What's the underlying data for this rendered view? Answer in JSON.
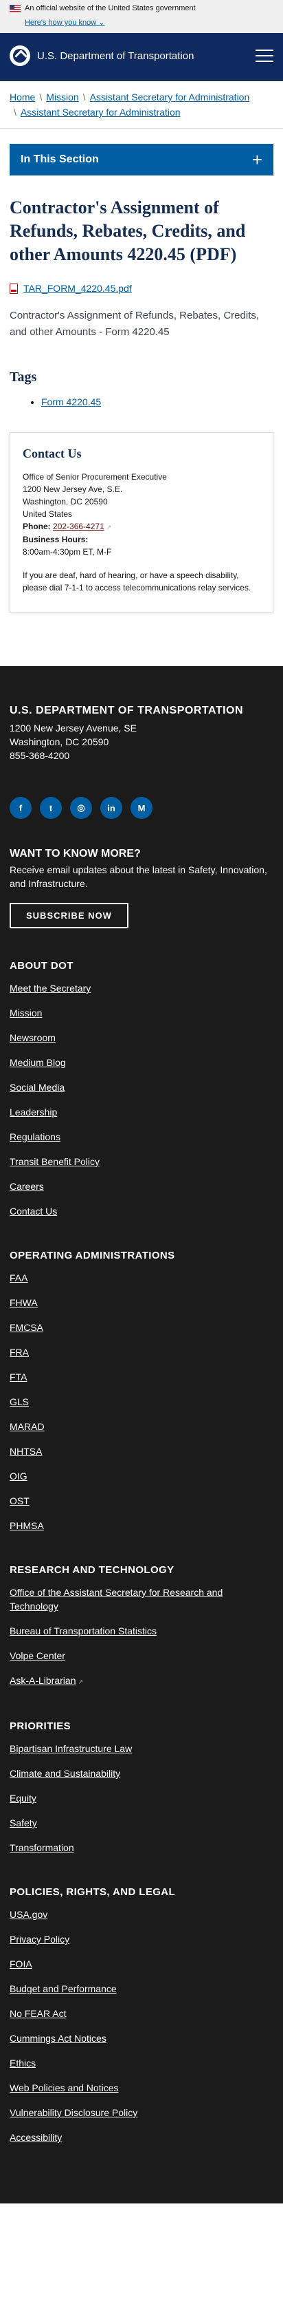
{
  "gov_banner": {
    "text": "An official website of the United States government",
    "how_know": "Here's how you know"
  },
  "header": {
    "site_name": "U.S. Department of Transportation"
  },
  "breadcrumb": [
    "Home",
    "Mission",
    "Assistant Secretary for Administration",
    "Assistant Secretary for Administration"
  ],
  "section_nav": {
    "label": "In This Section",
    "toggle": "+"
  },
  "page": {
    "title": "Contractor's Assignment of Refunds, Rebates, Credits, and other Amounts 4220.45 (PDF)",
    "file_name": "TAR_FORM_4220.45.pdf",
    "description": "Contractor's Assignment of Refunds, Rebates, Credits, and other Amounts - Form 4220.45",
    "tags_title": "Tags",
    "tags": [
      "Form 4220.45"
    ]
  },
  "contact": {
    "title": "Contact Us",
    "office": "Office of Senior Procurement Executive",
    "street": "1200 New Jersey Ave, S.E.",
    "city": "Washington, DC 20590",
    "country": "United States",
    "phone_label": "Phone:",
    "phone": "202-366-4271",
    "hours_label": "Business Hours:",
    "hours": "8:00am-4:30pm ET, M-F",
    "deaf_note": "If you are deaf, hard of hearing, or have a speech disability, please dial 7-1-1 to access telecommunications relay services."
  },
  "footer": {
    "org": "U.S. DEPARTMENT OF TRANSPORTATION",
    "address_line1": "1200 New Jersey Avenue, SE",
    "address_line2": "Washington, DC 20590",
    "phone": "855-368-4200",
    "socials": [
      {
        "name": "facebook-icon",
        "glyph": "f"
      },
      {
        "name": "twitter-icon",
        "glyph": "t"
      },
      {
        "name": "instagram-icon",
        "glyph": "◎"
      },
      {
        "name": "linkedin-icon",
        "glyph": "in"
      },
      {
        "name": "medium-icon",
        "glyph": "M"
      }
    ],
    "want_title": "WANT TO KNOW MORE?",
    "want_desc": "Receive email updates about the latest in Safety, Innovation, and Infrastructure.",
    "subscribe": "SUBSCRIBE NOW",
    "sections": [
      {
        "title": "ABOUT DOT",
        "links": [
          "Meet the Secretary",
          "Mission",
          "Newsroom",
          "Medium Blog",
          "Social Media",
          "Leadership",
          "Regulations",
          "Transit Benefit Policy",
          "Careers",
          "Contact Us"
        ]
      },
      {
        "title": "OPERATING ADMINISTRATIONS",
        "links": [
          "FAA",
          "FHWA",
          "FMCSA",
          "FRA",
          "FTA",
          "GLS",
          "MARAD",
          "NHTSA",
          "OIG",
          "OST",
          "PHMSA"
        ]
      },
      {
        "title": "RESEARCH AND TECHNOLOGY",
        "links": [
          "Office of the Assistant Secretary for Research and Technology",
          "Bureau of Transportation Statistics",
          "Volpe Center",
          "Ask-A-Librarian"
        ]
      },
      {
        "title": "PRIORITIES",
        "links": [
          "Bipartisan Infrastructure Law",
          "Climate and Sustainability",
          "Equity",
          "Safety",
          "Transformation"
        ]
      },
      {
        "title": "POLICIES, RIGHTS, AND LEGAL",
        "links": [
          "USA.gov",
          "Privacy Policy",
          "FOIA",
          "Budget and Performance",
          "No FEAR Act",
          "Cummings Act Notices",
          "Ethics",
          "Web Policies and Notices",
          "Vulnerability Disclosure Policy",
          "Accessibility"
        ]
      }
    ]
  }
}
